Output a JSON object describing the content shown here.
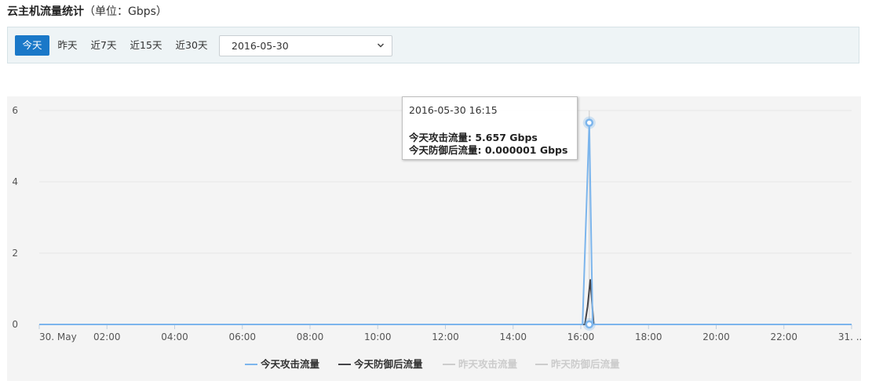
{
  "header": {
    "title": "云主机流量统计",
    "unit": "（单位：Gbps）"
  },
  "toolbar": {
    "ranges": [
      {
        "label": "今天",
        "active": true
      },
      {
        "label": "昨天",
        "active": false
      },
      {
        "label": "近7天",
        "active": false
      },
      {
        "label": "近15天",
        "active": false
      },
      {
        "label": "近30天",
        "active": false
      }
    ],
    "date_value": "2016-05-30",
    "chevron_icon": "chevron-down-icon"
  },
  "tooltip": {
    "time": "2016-05-30 16:15",
    "line1": "今天攻击流量: 5.657 Gbps",
    "line2": "今天防御后流量: 0.000001 Gbps"
  },
  "legend": [
    {
      "label": "今天攻击流量",
      "color": "#7cb5ec",
      "enabled": true
    },
    {
      "label": "今天防御后流量",
      "color": "#434348",
      "enabled": true
    },
    {
      "label": "昨天攻击流量",
      "color": "#cccccc",
      "enabled": false
    },
    {
      "label": "昨天防御后流量",
      "color": "#cccccc",
      "enabled": false
    }
  ],
  "chart_data": {
    "type": "line",
    "title": "",
    "xlabel": "",
    "ylabel": "",
    "ylim": [
      0,
      6
    ],
    "y_ticks": [
      0,
      2,
      4,
      6
    ],
    "x_range_hours": [
      0,
      24
    ],
    "x_tick_hours": [
      0,
      2,
      4,
      6,
      8,
      10,
      12,
      14,
      16,
      18,
      20,
      22,
      24
    ],
    "x_tick_labels": [
      "30. May",
      "02:00",
      "04:00",
      "06:00",
      "08:00",
      "10:00",
      "12:00",
      "14:00",
      "16:00",
      "18:00",
      "20:00",
      "22:00",
      "31. ..."
    ],
    "grid": true,
    "series": [
      {
        "name": "今天攻击流量",
        "color": "#7cb5ec",
        "points": [
          [
            0,
            0
          ],
          [
            16.0,
            0
          ],
          [
            16.05,
            0
          ],
          [
            16.25,
            5.657
          ],
          [
            16.35,
            0
          ],
          [
            24,
            0
          ]
        ]
      },
      {
        "name": "今天防御后流量",
        "color": "#434348",
        "points": [
          [
            0,
            0
          ],
          [
            16.12,
            0
          ],
          [
            16.2,
            0.5
          ],
          [
            16.28,
            1.25
          ],
          [
            16.38,
            0
          ],
          [
            24,
            0
          ]
        ]
      }
    ],
    "highlight_x_hours": 16.25
  }
}
